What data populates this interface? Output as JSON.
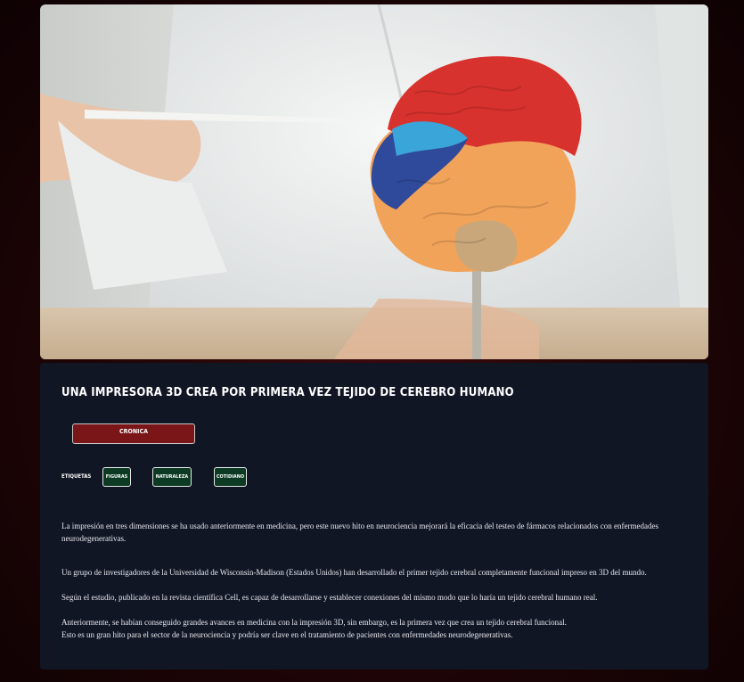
{
  "hero": {
    "image": "brain-model-photo"
  },
  "article": {
    "title": "Una impresora 3D crea por primera vez tejido de cerebro humano",
    "category": "Cronica",
    "tags_label": "Etiquetas",
    "tags": [
      "Figuras",
      "Naturaleza",
      "Cotidiano"
    ],
    "intro": "La impresión en tres dimensiones se ha usado anteriormente en medicina, pero este nuevo hito en neurociencia mejorará la eficacia del testeo de fármacos relacionados con enfermedades neurodegenerativas.",
    "paragraphs": [
      "Un grupo de investigadores de la Universidad de Wisconsin-Madison (Estados Unidos) han desarrollado el primer tejido cerebral completamente funcional impreso en 3D del mundo.",
      "Según el estudio, publicado en la revista científica Cell, es capaz de desarrollarse y establecer conexiones del mismo modo que lo haría un tejido cerebral humano real.",
      "Anteriormente, se habían conseguido grandes avances en medicina con la impresión 3D, sin embargo, es la primera vez que crea un tejido cerebral funcional.",
      "Esto es un gran hito para el sector de la neurociencia y podría ser clave en el tratamiento de pacientes con enfermedades neurodegenerativas."
    ]
  },
  "colors": {
    "background": "#1e0406",
    "card": "#101624",
    "category_button": "#7a1518",
    "tag_button": "#0d3a22"
  }
}
